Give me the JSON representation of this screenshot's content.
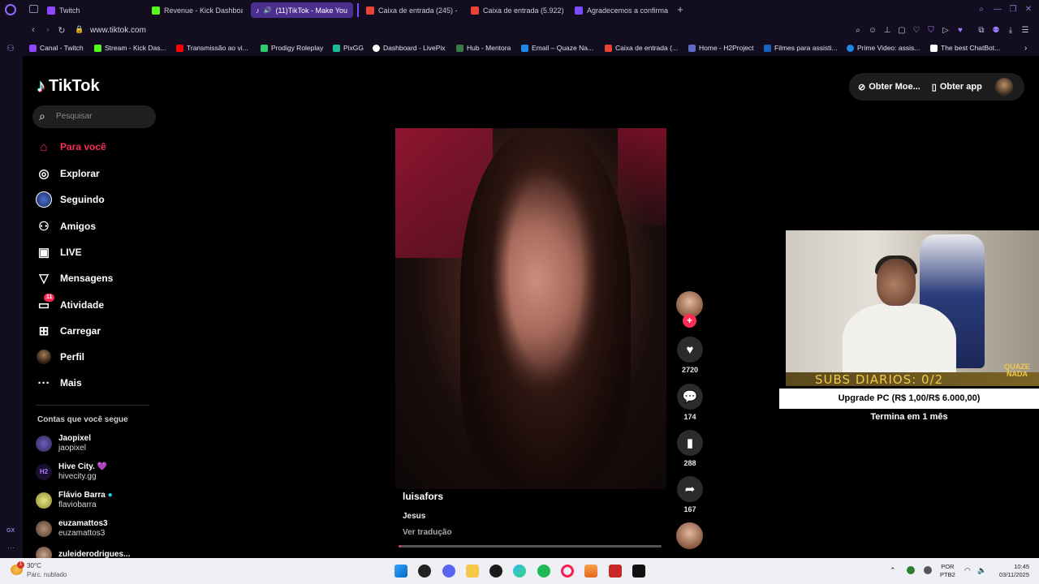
{
  "browser": {
    "tabs": [
      {
        "label": "Twitch",
        "color": "#9146ff",
        "active": false
      },
      {
        "label": "Revenue - Kick Dashboar",
        "color": "#53fc18",
        "active": false
      },
      {
        "label": "(11)TikTok - Make You",
        "color": "#000000",
        "active": true
      },
      {
        "label": "Caixa de entrada (245) -",
        "color": "#ea4335",
        "active": false
      },
      {
        "label": "Caixa de entrada (5.922)",
        "color": "#ea4335",
        "active": false
      },
      {
        "label": "Agradecemos a confirmaç",
        "color": "#7b4dff",
        "active": false
      }
    ],
    "url": "www.tiktok.com",
    "bookmarks": [
      {
        "label": "Canal - Twitch",
        "color": "#9146ff"
      },
      {
        "label": "Stream - Kick Das...",
        "color": "#53fc18"
      },
      {
        "label": "Transmissão ao vi...",
        "color": "#ff0000"
      },
      {
        "label": "Prodigy Roleplay",
        "color": "#2ecc71"
      },
      {
        "label": "PixGG",
        "color": "#1abc9c"
      },
      {
        "label": "Dashboard - LivePix",
        "color": "#ffffff"
      },
      {
        "label": "Hub - Mentora",
        "color": "#3a7d44"
      },
      {
        "label": "Email – Quaze Na...",
        "color": "#1e88e5"
      },
      {
        "label": "Caixa de entrada (...",
        "color": "#ea4335"
      },
      {
        "label": "Home - H2Project",
        "color": "#5c6bc0"
      },
      {
        "label": "Filmes para assisti...",
        "color": "#1565c0"
      },
      {
        "label": "Prime Video: assis...",
        "color": "#1e88e5"
      },
      {
        "label": "The best ChatBot...",
        "color": "#ffffff"
      }
    ]
  },
  "tiktok": {
    "logo": "TikTok",
    "search_placeholder": "Pesquisar",
    "nav": [
      {
        "label": "Para você",
        "icon": "home-icon"
      },
      {
        "label": "Explorar",
        "icon": "compass-icon"
      },
      {
        "label": "Seguindo",
        "icon": "following-avatar-icon"
      },
      {
        "label": "Amigos",
        "icon": "friends-icon"
      },
      {
        "label": "LIVE",
        "icon": "live-icon"
      },
      {
        "label": "Mensagens",
        "icon": "send-icon"
      },
      {
        "label": "Atividade",
        "icon": "activity-icon",
        "badge": "11"
      },
      {
        "label": "Carregar",
        "icon": "upload-icon"
      },
      {
        "label": "Perfil",
        "icon": "profile-avatar-icon"
      },
      {
        "label": "Mais",
        "icon": "more-icon"
      }
    ],
    "following_title": "Contas que você segue",
    "following": [
      {
        "name": "Jaopixel",
        "handle": "jaopixel"
      },
      {
        "name": "Hive City. 💜",
        "handle": "hivecity.gg"
      },
      {
        "name": "Flávio Barra",
        "handle": "flaviobarra"
      },
      {
        "name": "euzamattos3",
        "handle": "euzamattos3"
      },
      {
        "name": "zuleiderodrigues...",
        "handle": ""
      }
    ],
    "topright": {
      "coins": "Obter Moe...",
      "app": "Obter app"
    },
    "video": {
      "author": "luisafors",
      "description": "Jesus",
      "translate": "Ver tradução",
      "progress": 0.01
    },
    "actions": {
      "likes": "2720",
      "comments": "174",
      "saves": "288",
      "shares": "167"
    },
    "accent": "#fe2c55"
  },
  "overlay": {
    "subs": "SUBS DIARIOS: 0/2",
    "logo": "QUAZE NADA",
    "goal": "Upgrade PC (R$ 1,00/R$ 6.000,00)",
    "goal_end": "Termina em 1 mês"
  },
  "taskbar": {
    "temp": "30°C",
    "weather": "Parc. nublado",
    "weather_badge": "1",
    "lang": "POR",
    "layout": "PTB2",
    "time": "10:45",
    "date": "03/11/2025"
  }
}
